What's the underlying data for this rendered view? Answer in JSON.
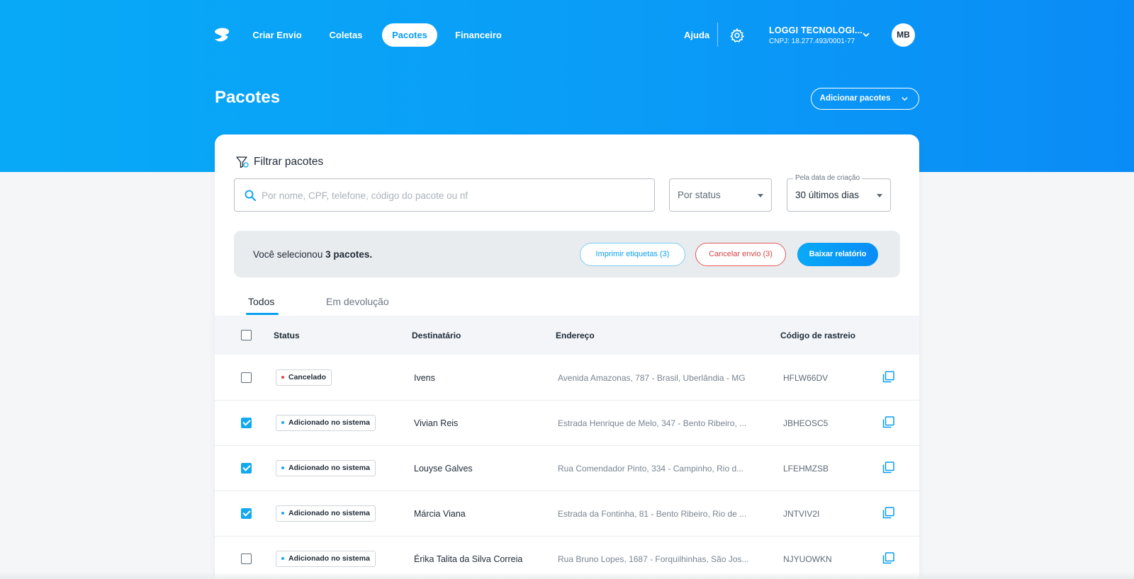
{
  "nav": {
    "links": [
      {
        "label": "Criar Envio",
        "active": false
      },
      {
        "label": "Coletas",
        "active": false
      },
      {
        "label": "Pacotes",
        "active": true
      },
      {
        "label": "Financeiro",
        "active": false
      }
    ],
    "help_label": "Ajuda",
    "settings_icon": "gear-icon",
    "company": {
      "name": "LOGGI TECNOLOGI...",
      "cnpj": "CNPJ: 18.277.493/0001-77"
    },
    "avatar_initials": "MB"
  },
  "page": {
    "title": "Pacotes",
    "add_button_label": "Adicionar pacotes"
  },
  "filter": {
    "title": "Filtrar pacotes",
    "search_placeholder": "Por nome, CPF, telefone, código do pacote ou nf",
    "status_select": "Por status",
    "date_legend": "Pela data de criação",
    "date_select": "30 últimos dias"
  },
  "selection": {
    "prefix": "Você selecionou ",
    "count_text": "3 pacotes.",
    "print_label": "Imprimir etiquetas (3)",
    "cancel_label": "Cancelar envio (3)",
    "download_label": "Baixar relatório"
  },
  "tabs": [
    {
      "label": "Todos",
      "active": true
    },
    {
      "label": "Em devolução",
      "active": false
    }
  ],
  "table": {
    "headers": {
      "status": "Status",
      "recipient": "Destinatário",
      "address": "Endereço",
      "tracking": "Código de rastreio"
    },
    "rows": [
      {
        "checked": false,
        "status": "Cancelado",
        "status_color": "#e2434b",
        "recipient": "Ivens",
        "address": "Avenida Amazonas, 787 - Brasil, Uberlândia - MG",
        "tracking": "HFLW66DV"
      },
      {
        "checked": true,
        "status": "Adicionado no sistema",
        "status_color": "#14a9ef",
        "recipient": "Vivian Reis",
        "address": "Estrada Henrique de Melo, 347 - Bento Ribeiro, ...",
        "tracking": "JBHEOSC5"
      },
      {
        "checked": true,
        "status": "Adicionado no sistema",
        "status_color": "#14a9ef",
        "recipient": "Louyse Galves",
        "address": "Rua Comendador Pinto, 334 - Campinho, Rio d...",
        "tracking": "LFEHMZSB"
      },
      {
        "checked": true,
        "status": "Adicionado no sistema",
        "status_color": "#14a9ef",
        "recipient": "Márcia Viana",
        "address": "Estrada da Fontinha, 81 - Bento Ribeiro, Rio de ...",
        "tracking": "JNTVIV2I"
      },
      {
        "checked": false,
        "status": "Adicionado no sistema",
        "status_color": "#14a9ef",
        "recipient": "Érika Talita da Silva Correia",
        "address": "Rua Bruno Lopes, 1687 - Forquilhinhas, São Jos...",
        "tracking": "NJYUOWKN"
      }
    ]
  },
  "colors": {
    "brand": "#0a9cf7",
    "danger": "#d64545"
  }
}
